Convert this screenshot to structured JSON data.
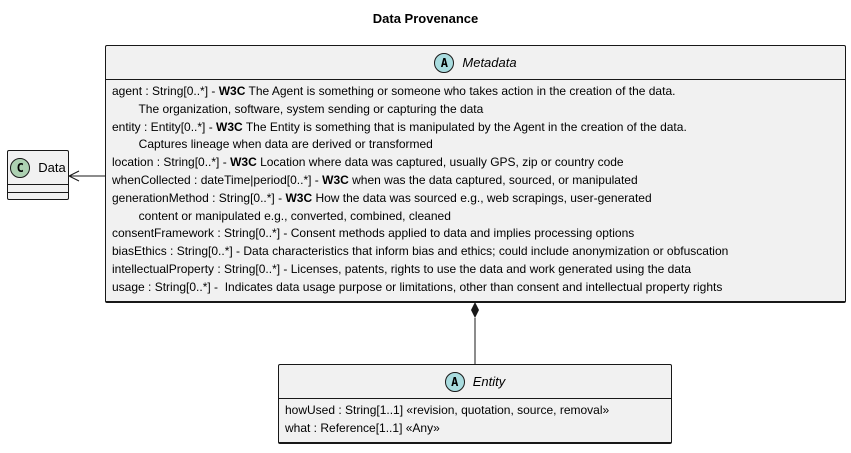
{
  "title": "Data Provenance",
  "colors": {
    "box_fill": "#f1f1f1",
    "border": "#181818",
    "abstract_circle": "#a9dcdf",
    "class_circle": "#add1b2"
  },
  "classes": {
    "data": {
      "stereotype": "C",
      "name": "Data",
      "attributes": []
    },
    "metadata": {
      "stereotype": "A",
      "name": "Metadata",
      "attributes": [
        {
          "pre": "agent : String[0..*] - ",
          "w3c": "W3C",
          "post": " The Agent is something or someone who takes action in the creation of the data."
        },
        {
          "pre": "        The organization, software, system sending or capturing the data",
          "w3c": "",
          "post": ""
        },
        {
          "pre": "entity : Entity[0..*] - ",
          "w3c": "W3C",
          "post": " The Entity is something that is manipulated by the Agent in the creation of the data."
        },
        {
          "pre": "        Captures lineage when data are derived or transformed",
          "w3c": "",
          "post": ""
        },
        {
          "pre": "location : String[0..*] - ",
          "w3c": "W3C",
          "post": " Location where data was captured, usually GPS, zip or country code"
        },
        {
          "pre": "whenCollected : dateTime|period[0..*] - ",
          "w3c": "W3C",
          "post": " when was the data captured, sourced, or manipulated"
        },
        {
          "pre": "generationMethod : String[0..*] - ",
          "w3c": "W3C",
          "post": " How the data was sourced e.g., web scrapings, user-generated"
        },
        {
          "pre": "        content or manipulated e.g., converted, combined, cleaned",
          "w3c": "",
          "post": ""
        },
        {
          "pre": "consentFramework : String[0..*] - Consent methods applied to data and implies processing options",
          "w3c": "",
          "post": ""
        },
        {
          "pre": "biasEthics : String[0..*] - Data characteristics that inform bias and ethics; could include anonymization or obfuscation",
          "w3c": "",
          "post": ""
        },
        {
          "pre": "intellectualProperty : String[0..*] - Licenses, patents, rights to use the data and work generated using the data",
          "w3c": "",
          "post": ""
        },
        {
          "pre": "usage : String[0..*] -  Indicates data usage purpose or limitations, other than consent and intellectual property rights",
          "w3c": "",
          "post": ""
        }
      ]
    },
    "entity": {
      "stereotype": "A",
      "name": "Entity",
      "attributes": [
        {
          "pre": "howUsed : String[1..1] «revision, quotation, source, removal»",
          "w3c": "",
          "post": ""
        },
        {
          "pre": "what : Reference[1..1] «Any»",
          "w3c": "",
          "post": ""
        }
      ]
    }
  }
}
